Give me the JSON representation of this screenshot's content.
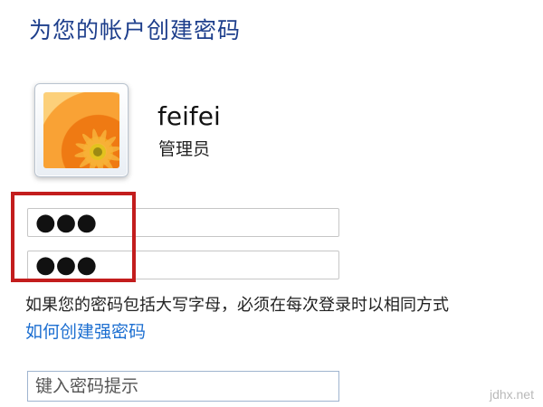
{
  "title": "为您的帐户创建密码",
  "user": {
    "name": "feifei",
    "role": "管理员"
  },
  "password": {
    "value": "●●●"
  },
  "confirm_password": {
    "value": "●●●"
  },
  "case_note": "如果您的密码包括大写字母，必须在每次登录时以相同方式",
  "strong_password_link": "如何创建强密码",
  "hint": {
    "placeholder": "键入密码提示"
  },
  "watermark": "jdhx.net",
  "colors": {
    "title": "#1e3f8c",
    "link": "#1d6fd1",
    "highlight_box": "#c31d1d"
  }
}
